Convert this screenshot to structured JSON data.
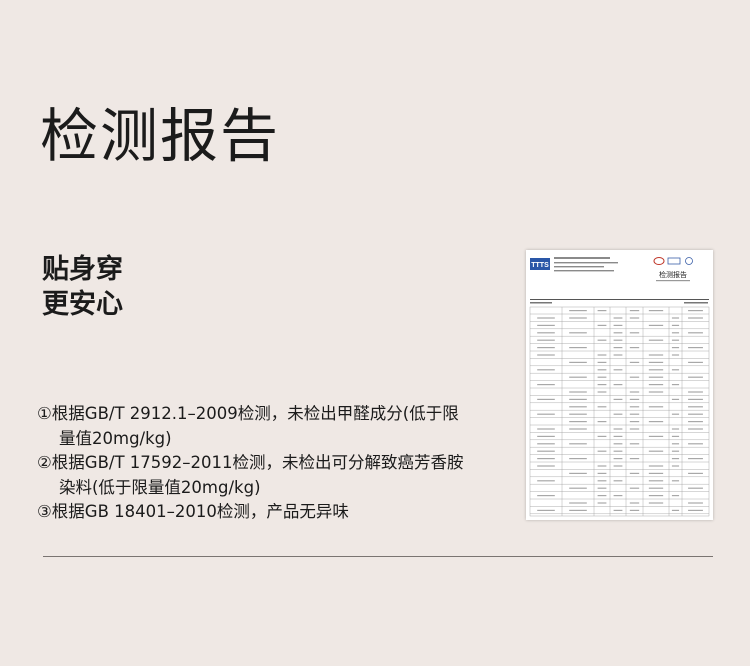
{
  "page": {
    "title": "检测报告",
    "tagline": [
      "贴身穿",
      "更安心"
    ],
    "notes": [
      {
        "marker": "①",
        "lines": [
          "根据GB/T 2912.1–2009检测，未检出甲醛成分(低于限",
          "量值20mg/kg)"
        ]
      },
      {
        "marker": "②",
        "lines": [
          "根据GB/T 17592–2011检测，未检出可分解致癌芳香胺",
          "染料(低于限量值20mg/kg)"
        ]
      },
      {
        "marker": "③",
        "lines": [
          "根据GB 18401–2010检测，产品无异味"
        ]
      }
    ]
  },
  "report": {
    "logo_text": "TTTS",
    "heading": "检测报告",
    "brand_color": "#2a57a8"
  }
}
